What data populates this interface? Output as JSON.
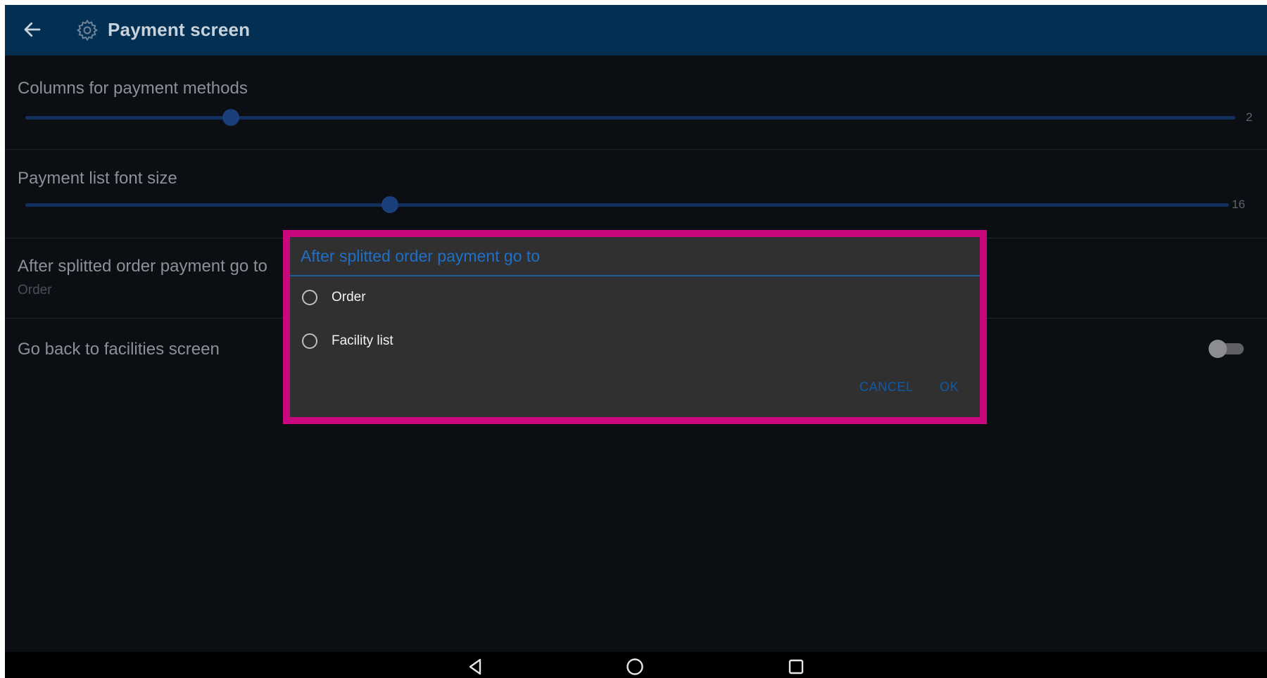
{
  "appbar": {
    "title": "Payment screen",
    "back_icon": "arrow-left-icon",
    "settings_icon": "gear-icon",
    "background": "#032f52"
  },
  "settings": [
    {
      "label": "Columns for payment methods",
      "type": "slider",
      "value": "2",
      "fraction": 0.17
    },
    {
      "label": "Payment list font size",
      "type": "slider",
      "value": "16",
      "fraction": 0.303
    },
    {
      "label": "After splitted order payment go to",
      "type": "list",
      "summary": "Order"
    },
    {
      "label": "Go back to facilities screen",
      "type": "switch",
      "checked": false
    }
  ],
  "dialog": {
    "title": "After splitted order payment go to",
    "options": [
      {
        "label": "Order",
        "selected": false
      },
      {
        "label": "Facility list",
        "selected": false
      }
    ],
    "cancel_label": "CANCEL",
    "ok_label": "OK",
    "highlight_color": "#c9087e",
    "accent": "#1f6fc9"
  },
  "navbar": {
    "icons": [
      "back-triangle-icon",
      "home-circle-icon",
      "recents-square-icon"
    ]
  }
}
